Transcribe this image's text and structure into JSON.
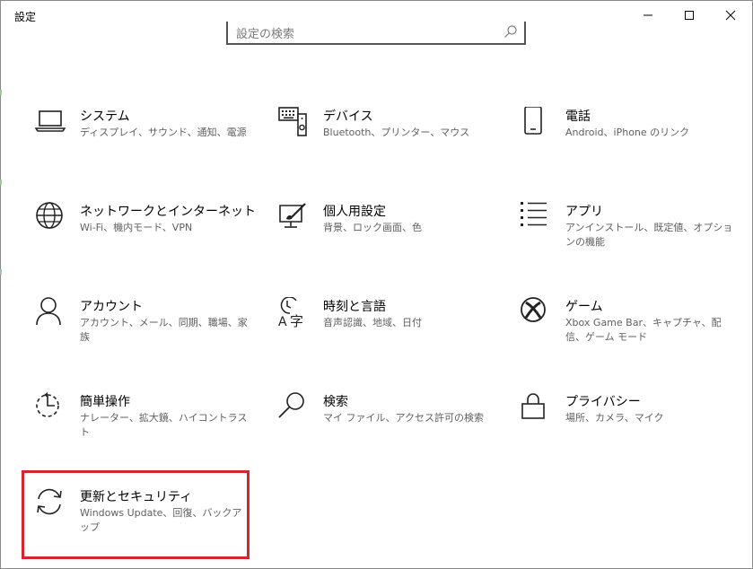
{
  "window": {
    "title": "設定"
  },
  "search": {
    "placeholder": "設定の検索"
  },
  "tiles": [
    {
      "name": "システム",
      "desc": "ディスプレイ、サウンド、通知、電源",
      "icon": "laptop-icon"
    },
    {
      "name": "デバイス",
      "desc": "Bluetooth、プリンター、マウス",
      "icon": "devices-icon"
    },
    {
      "name": "電話",
      "desc": "Android、iPhone のリンク",
      "icon": "phone-icon"
    },
    {
      "name": "ネットワークとインターネット",
      "desc": "Wi-Fi、機内モード、VPN",
      "icon": "globe-icon"
    },
    {
      "name": "個人用設定",
      "desc": "背景、ロック画面、色",
      "icon": "personalization-icon"
    },
    {
      "name": "アプリ",
      "desc": "アンインストール、既定値、オプションの機能",
      "icon": "apps-list-icon"
    },
    {
      "name": "アカウント",
      "desc": "アカウント、メール、同期、職場、家族",
      "icon": "person-icon"
    },
    {
      "name": "時刻と言語",
      "desc": "音声認識、地域、日付",
      "icon": "time-language-icon"
    },
    {
      "name": "ゲーム",
      "desc": "Xbox Game Bar、キャプチャ、配信、ゲーム モード",
      "icon": "xbox-icon"
    },
    {
      "name": "簡単操作",
      "desc": "ナレーター、拡大鏡、ハイコントラスト",
      "icon": "ease-of-access-icon"
    },
    {
      "name": "検索",
      "desc": "マイ ファイル、アクセス許可の検索",
      "icon": "search-icon"
    },
    {
      "name": "プライバシー",
      "desc": "場所、カメラ、マイク",
      "icon": "lock-icon"
    },
    {
      "name": "更新とセキュリティ",
      "desc": "Windows Update、回復、バックアップ",
      "icon": "sync-icon"
    }
  ],
  "colors": {
    "highlight": "#d42530",
    "icon": "#222222",
    "description": "#5f5f5f"
  }
}
